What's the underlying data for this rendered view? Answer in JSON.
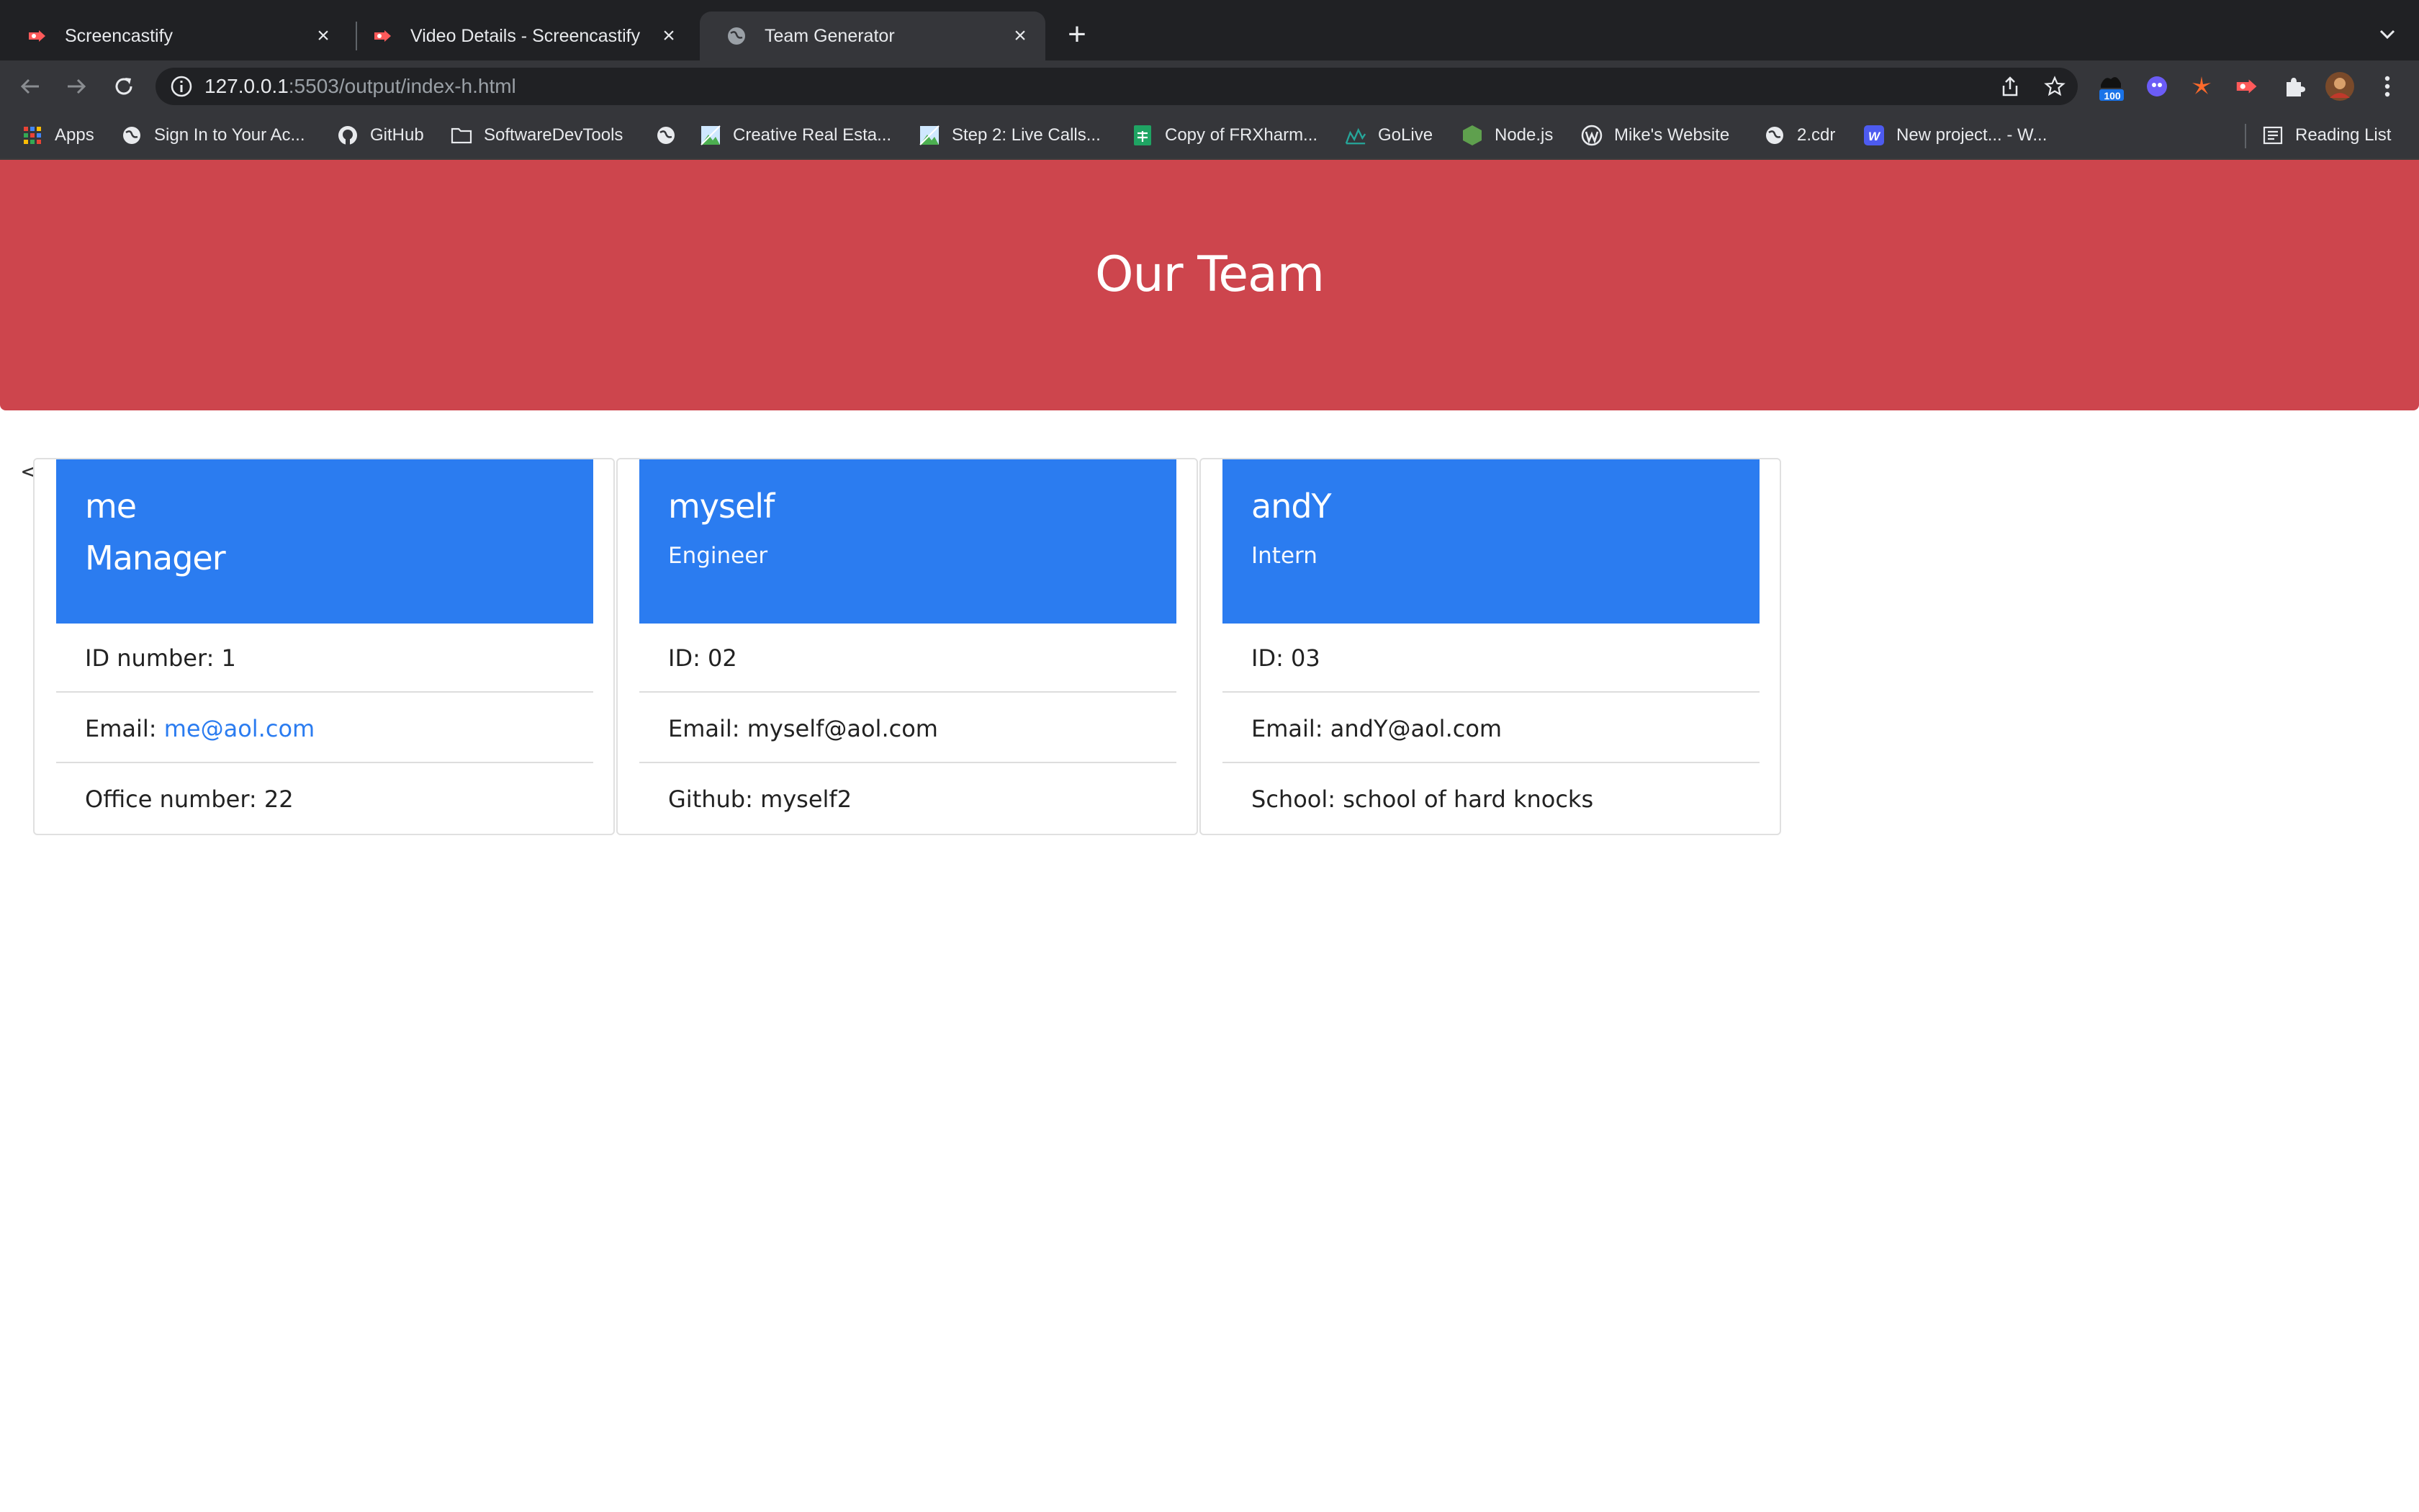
{
  "browser": {
    "tabs": [
      {
        "title": "Screencastify",
        "icon": "screencastify-icon",
        "active": false
      },
      {
        "title": "Video Details - Screencastify",
        "icon": "screencastify-icon",
        "active": false
      },
      {
        "title": "Team Generator",
        "icon": "globe-icon",
        "active": true
      }
    ],
    "address": {
      "host": "127.0.0.1",
      "rest": ":5503/output/index-h.html"
    },
    "extension_badge": "100",
    "bookmarks": [
      {
        "label": "Apps",
        "icon": "apps-grid-icon"
      },
      {
        "label": "Sign In to Your Ac...",
        "icon": "globe-icon"
      },
      {
        "label": "GitHub",
        "icon": "github-icon"
      },
      {
        "label": "SoftwareDevTools",
        "icon": "folder-icon"
      },
      {
        "label": "",
        "icon": "globe-icon"
      },
      {
        "label": "Creative Real Esta...",
        "icon": "image-icon"
      },
      {
        "label": "Step 2: Live Calls...",
        "icon": "image-icon"
      },
      {
        "label": "Copy of FRXharm...",
        "icon": "sheets-icon"
      },
      {
        "label": "GoLive",
        "icon": "golive-icon"
      },
      {
        "label": "Node.js",
        "icon": "nodejs-icon"
      },
      {
        "label": "Mike's Website",
        "icon": "wordpress-icon"
      },
      {
        "label": "2.cdr",
        "icon": "globe-icon"
      },
      {
        "label": "New project... - W...",
        "icon": "w-icon"
      }
    ],
    "reading_list": "Reading List"
  },
  "page": {
    "title": "Our Team",
    "stray_text": "<",
    "cards": [
      {
        "name": "me",
        "role": "Manager",
        "rows": [
          {
            "text": "ID number: 1"
          },
          {
            "prefix": "Email: ",
            "link": "me@aol.com"
          },
          {
            "text": "Office number: 22"
          }
        ]
      },
      {
        "name": "myself",
        "role": "Engineer",
        "rows": [
          {
            "text": "ID: 02"
          },
          {
            "text": "Email: myself@aol.com"
          },
          {
            "text": "Github: myself2"
          }
        ]
      },
      {
        "name": "andY",
        "role": "Intern",
        "rows": [
          {
            "text": "ID: 03"
          },
          {
            "text": "Email: andY@aol.com"
          },
          {
            "text": "School: school of hard knocks"
          }
        ]
      }
    ]
  },
  "colors": {
    "jumbotron": "#cd454d",
    "card_header": "#2b7cf0",
    "link": "#2b7cf0"
  }
}
